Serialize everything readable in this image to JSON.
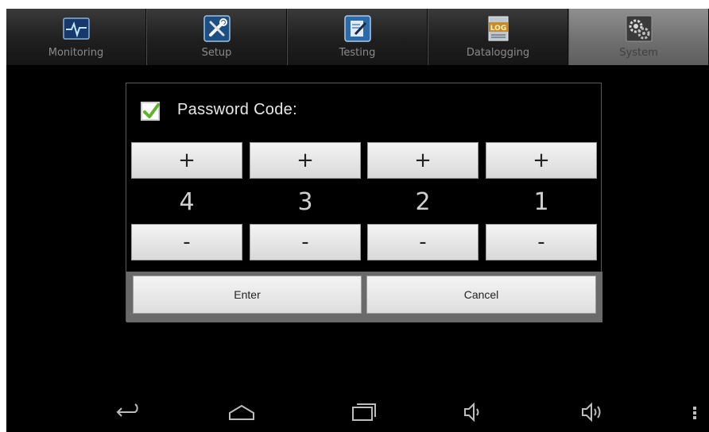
{
  "tabs": [
    {
      "label": "Monitoring",
      "icon": "monitoring-icon",
      "active": false
    },
    {
      "label": "Setup",
      "icon": "tools-icon",
      "active": false
    },
    {
      "label": "Testing",
      "icon": "notepad-icon",
      "active": false
    },
    {
      "label": "Datalogging",
      "icon": "log-icon",
      "active": false
    },
    {
      "label": "System",
      "icon": "gear-icon",
      "active": true
    }
  ],
  "dialog": {
    "title": "Password Code:",
    "checked": true,
    "digits": [
      {
        "plus": "+",
        "value": "4",
        "minus": "-"
      },
      {
        "plus": "+",
        "value": "3",
        "minus": "-"
      },
      {
        "plus": "+",
        "value": "2",
        "minus": "-"
      },
      {
        "plus": "+",
        "value": "1",
        "minus": "-"
      }
    ],
    "enter_label": "Enter",
    "cancel_label": "Cancel"
  },
  "navbar": {
    "icons": [
      "back-icon",
      "home-icon",
      "recent-apps-icon",
      "volume-down-icon",
      "volume-up-icon",
      "menu-icon"
    ]
  },
  "colors": {
    "accent_check": "#5fb32a",
    "active_tab": "#7e7e7e",
    "background": "#000000"
  }
}
